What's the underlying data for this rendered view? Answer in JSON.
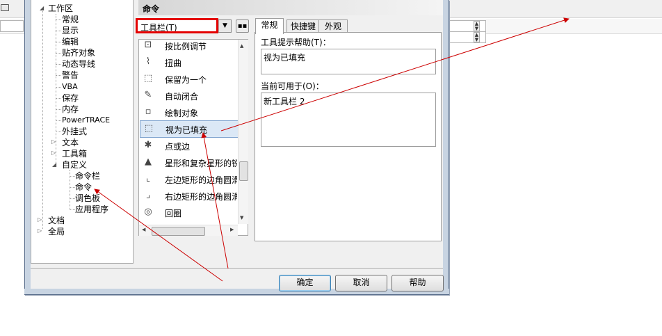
{
  "dialog": {
    "panel_title": "命令",
    "tree": {
      "workspace": "工作区",
      "children": [
        "常规",
        "显示",
        "编辑",
        "贴齐对象",
        "动态导线",
        "警告",
        "VBA",
        "保存",
        "内存",
        "PowerTRACE",
        "外挂式"
      ],
      "text": "文本",
      "toolbox": "工具箱",
      "customize": "自定义",
      "customize_children": [
        "命令栏",
        "命令",
        "调色板",
        "应用程序"
      ],
      "document": "文档",
      "global": "全局"
    },
    "combo": {
      "value": "工具栏(T)"
    },
    "commands": [
      "按比例调节",
      "扭曲",
      "保留为一个",
      "自动闭合",
      "绘制对象",
      "视为已填充",
      "点或边",
      "星形和复杂星形的锐",
      "左边矩形的边角圆滑",
      "右边矩形的边角圆滑",
      "回圈"
    ],
    "selected_command": "视为已填充",
    "tabs": [
      "常规",
      "快捷键",
      "外观"
    ],
    "tooltip_label": "工具提示帮助(T)：",
    "tooltip_value": "视为已填充",
    "available_label": "当前可用于(O)：",
    "available_value": "新工具栏 2",
    "buttons": {
      "ok": "确定",
      "cancel": "取消",
      "help": "帮助"
    }
  },
  "colors": {
    "highlight_box": "#e40000",
    "annotation_arrow": "#cc0000",
    "selection": "#dbe8f6"
  }
}
